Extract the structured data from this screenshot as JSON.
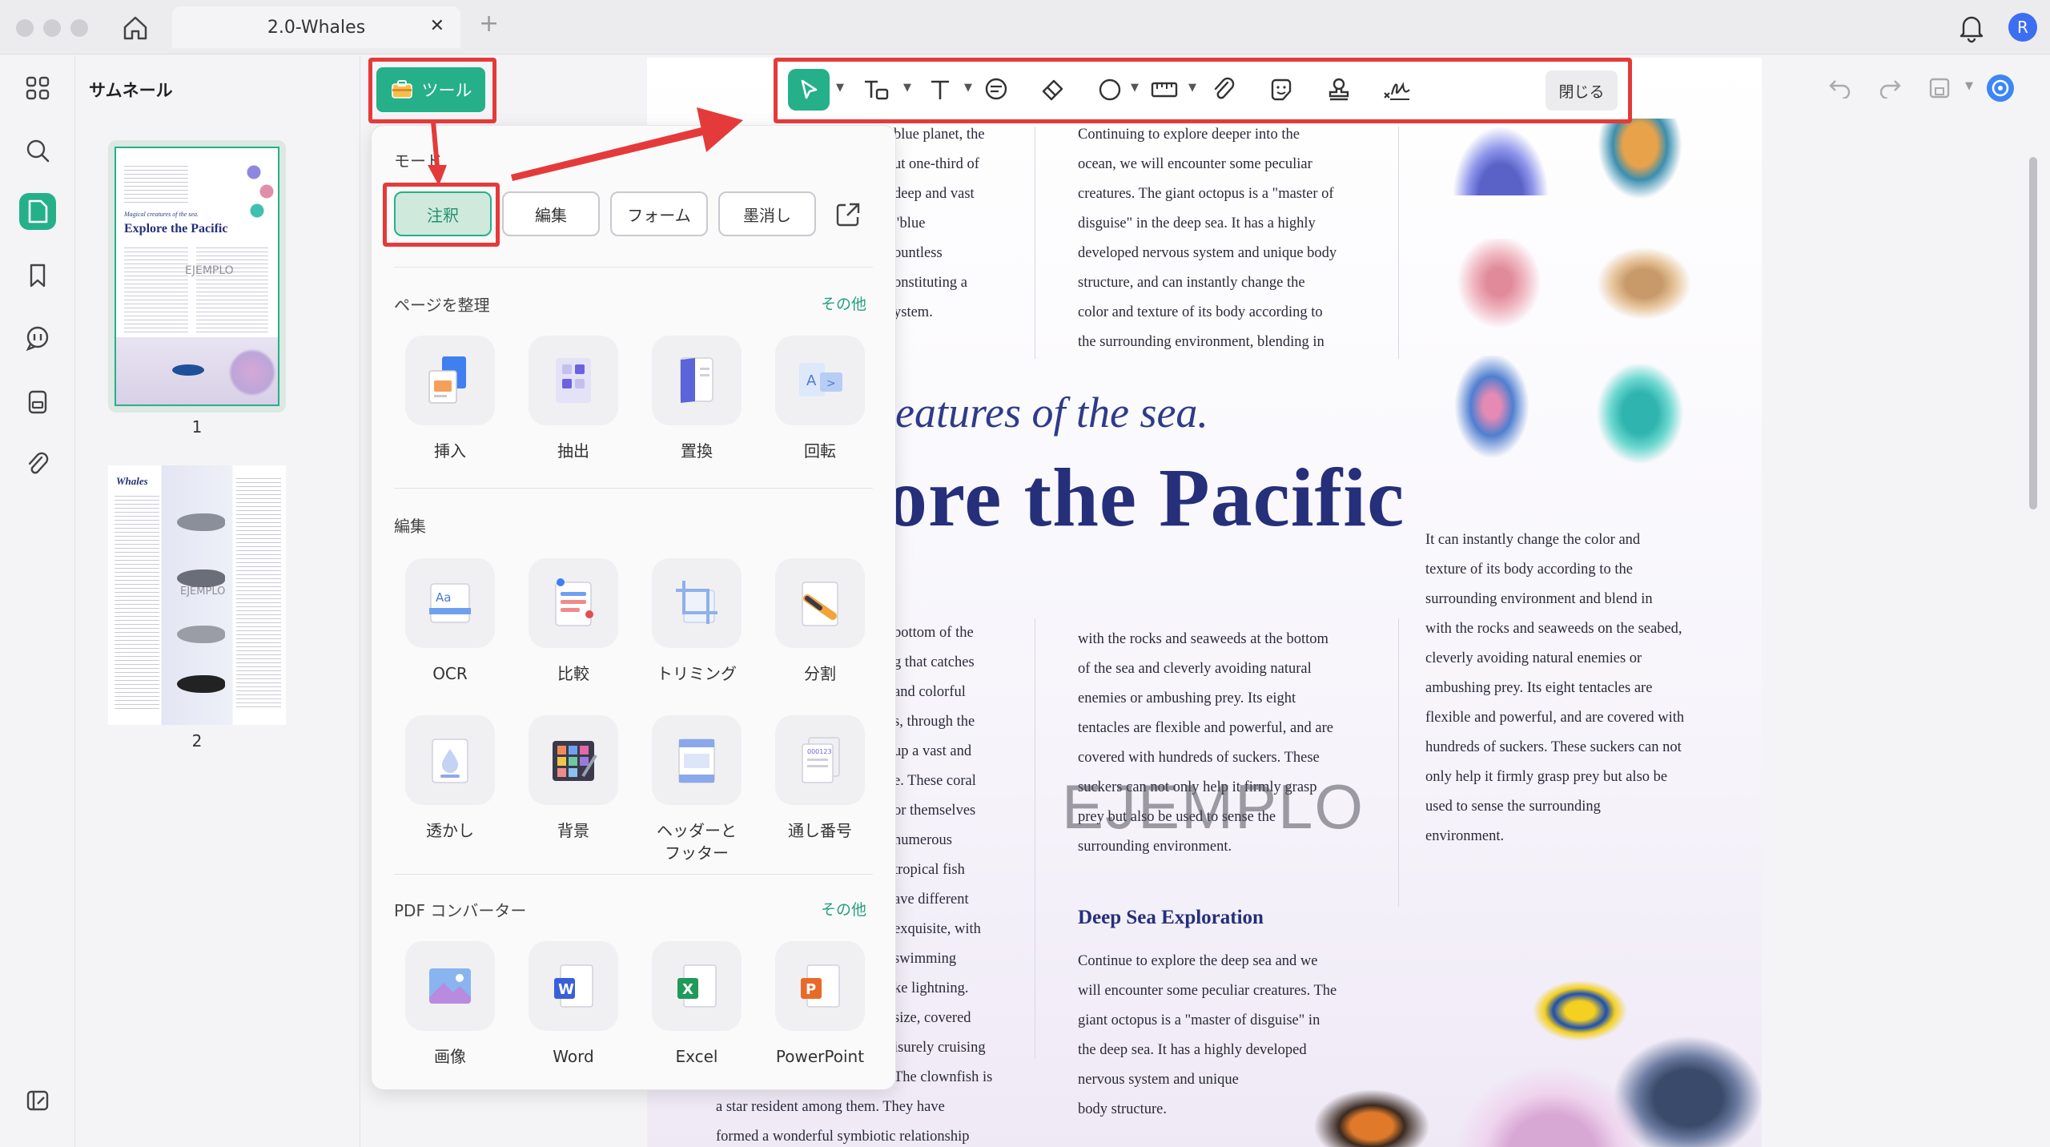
{
  "window": {
    "tab_title": "2.0-Whales",
    "tab_close": "✕",
    "tab_add": "+",
    "avatar_initial": "R"
  },
  "thumbnails": {
    "title": "サムネール",
    "pages": [
      {
        "number": "1",
        "heading_small": "Magical creatures of the sea.",
        "heading": "Explore the Pacific",
        "watermark": "EJEMPLO"
      },
      {
        "number": "2",
        "heading": "Whales",
        "watermark": "EJEMPLO"
      }
    ]
  },
  "tools_button": {
    "label": "ツール"
  },
  "tools_panel": {
    "mode_section": "モード",
    "modes": [
      {
        "label": "注釈",
        "active": true
      },
      {
        "label": "編集",
        "active": false
      },
      {
        "label": "フォーム",
        "active": false
      },
      {
        "label": "墨消し",
        "active": false
      }
    ],
    "organize": {
      "title": "ページを整理",
      "more": "その他",
      "items": [
        {
          "label": "挿入",
          "icon": "insert-page-icon"
        },
        {
          "label": "抽出",
          "icon": "extract-page-icon"
        },
        {
          "label": "置換",
          "icon": "replace-page-icon"
        },
        {
          "label": "回転",
          "icon": "rotate-page-icon"
        }
      ]
    },
    "edit": {
      "title": "編集",
      "items": [
        {
          "label": "OCR",
          "icon": "ocr-icon"
        },
        {
          "label": "比較",
          "icon": "compare-icon"
        },
        {
          "label": "トリミング",
          "icon": "crop-icon"
        },
        {
          "label": "分割",
          "icon": "split-icon"
        },
        {
          "label": "透かし",
          "icon": "watermark-icon"
        },
        {
          "label": "背景",
          "icon": "background-icon"
        },
        {
          "label": "ヘッダーと\nフッター",
          "icon": "header-footer-icon"
        },
        {
          "label": "通し番号",
          "icon": "bates-number-icon"
        }
      ]
    },
    "converter": {
      "title": "PDF コンバーター",
      "more": "その他",
      "items": [
        {
          "label": "画像",
          "icon": "image-icon"
        },
        {
          "label": "Word",
          "icon": "word-icon"
        },
        {
          "label": "Excel",
          "icon": "excel-icon"
        },
        {
          "label": "PowerPoint",
          "icon": "powerpoint-icon"
        }
      ]
    }
  },
  "annotation_toolbar": {
    "close_label": "閉じる"
  },
  "document": {
    "col1_top": [
      "blue planet, the",
      "ut one-third of",
      "deep and vast",
      "\"blue",
      "ountless",
      "onstituting a",
      "ystem."
    ],
    "col2_top": [
      "Continuing to explore deeper into the",
      "ocean, we will encounter some peculiar",
      "creatures. The giant octopus is a \"master of",
      "disguise\" in the deep sea. It has a highly",
      "developed nervous system and unique body",
      "structure, and can instantly change the",
      "color and texture of its body according to",
      "the surrounding environment, blending in"
    ],
    "subtitle": "eatures of the sea.",
    "title": "ore the Pacific",
    "col3_mid": [
      "It can instantly change the color and",
      "texture of its body according to the",
      "surrounding environment and blend in",
      "with the rocks and seaweeds on the seabed,",
      "cleverly avoiding natural enemies or",
      "ambushing prey. Its eight tentacles are",
      "flexible and powerful, and are covered with",
      "hundreds of suckers. These suckers can not",
      "only help it firmly grasp prey but also be",
      "used to sense the surrounding",
      "environment."
    ],
    "col1_bottom": [
      "bottom of the",
      "g that catches",
      "and colorful",
      "s, through the",
      "up a vast and",
      "e. These coral",
      "or themselves",
      "numerous",
      "tropical fish",
      "ave different",
      "exquisite, with",
      "swimming",
      "ke lightning.",
      "size, covered",
      "isurely cruising",
      "The clownfish is",
      "a star resident among them. They have",
      "formed a wonderful symbiotic relationship"
    ],
    "col2_bottom": [
      "with the rocks and seaweeds at the bottom",
      "of the sea and cleverly avoiding natural",
      "enemies or ambushing prey. Its eight",
      "tentacles are flexible and powerful, and are",
      "covered with hundreds of suckers. These",
      "suckers can not only help it firmly grasp",
      "prey but also be used to sense the",
      "surrounding environment."
    ],
    "deep_sea_heading": "Deep Sea Exploration",
    "deep_sea_text": [
      "Continue to explore the deep sea and we",
      "will encounter some peculiar creatures. The",
      "giant octopus is a \"master of disguise\" in",
      "the deep sea. It has a highly developed",
      "nervous system and unique",
      "body structure."
    ],
    "watermark": "EJEMPLO"
  },
  "colors": {
    "accent": "#25b08a",
    "highlight_red": "#e53a3a",
    "title_navy": "#252f7a"
  }
}
